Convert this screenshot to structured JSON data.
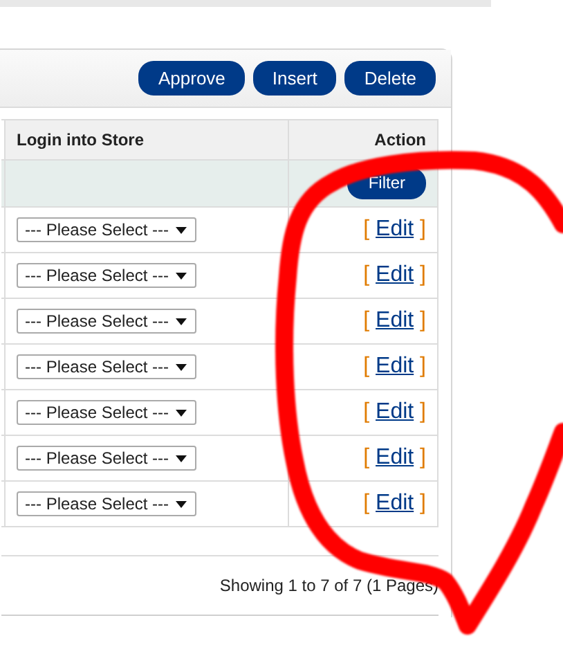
{
  "toolbar": {
    "buttons": [
      "Approve",
      "Insert",
      "Delete"
    ]
  },
  "table": {
    "columns": [
      "Login into Store",
      "Action"
    ],
    "filter_button": "Filter",
    "rows": [
      {
        "login_into_store": "--- Please Select ---",
        "action_open": "[",
        "action": "Edit",
        "action_close": "]"
      },
      {
        "login_into_store": "--- Please Select ---",
        "action_open": "[",
        "action": "Edit",
        "action_close": "]"
      },
      {
        "login_into_store": "--- Please Select ---",
        "action_open": "[",
        "action": "Edit",
        "action_close": "]"
      },
      {
        "login_into_store": "--- Please Select ---",
        "action_open": "[",
        "action": "Edit",
        "action_close": "]"
      },
      {
        "login_into_store": "--- Please Select ---",
        "action_open": "[",
        "action": "Edit",
        "action_close": "]"
      },
      {
        "login_into_store": "--- Please Select ---",
        "action_open": "[",
        "action": "Edit",
        "action_close": "]"
      },
      {
        "login_into_store": "--- Please Select ---",
        "action_open": "[",
        "action": "Edit",
        "action_close": "]"
      }
    ]
  },
  "pagination": {
    "text": "Showing 1 to 7 of 7 (1 Pages)"
  },
  "annotation": {
    "kind": "loop"
  }
}
